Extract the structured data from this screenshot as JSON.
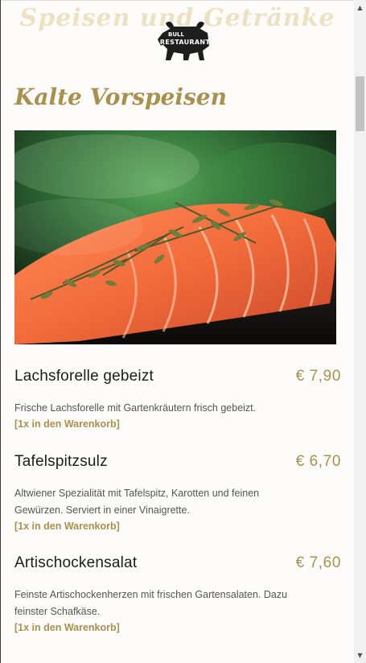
{
  "header": {
    "bg_title": "Speisen und Getränke",
    "logo_top": "BULL",
    "logo_bottom": "RESTAURANT"
  },
  "section": {
    "title": "Kalte Vorspeisen"
  },
  "hero": {
    "alt": "salmon-dish-photo"
  },
  "items": [
    {
      "name": "Lachsforelle gebeizt",
      "price": "€ 7,90",
      "desc_lines": [
        "Frische Lachsforelle mit Gartenkräutern frisch gebeizt."
      ],
      "cart": "[1x in den Warenkorb]"
    },
    {
      "name": "Tafelspitzsulz",
      "price": "€ 6,70",
      "desc_lines": [
        "Altwiener Spezialität mit Tafelspitz, Karotten und feinen",
        "Gewürzen. Serviert in einer Vinaigrette."
      ],
      "cart": "[1x in den Warenkorb]"
    },
    {
      "name": "Artischockensalat",
      "price": "€ 7,60",
      "desc_lines": [
        "Feinste Artischockenherzen mit frischen Gartensalaten. Dazu",
        "feinster Schafkäse."
      ],
      "cart": "[1x in den Warenkorb]"
    }
  ],
  "colors": {
    "accent": "#a8904e",
    "text": "#1c1c1c",
    "muted": "#555555",
    "background": "#fdfcfa"
  },
  "scrollbar": {
    "up_icon": "▲",
    "down_icon": "▼"
  }
}
